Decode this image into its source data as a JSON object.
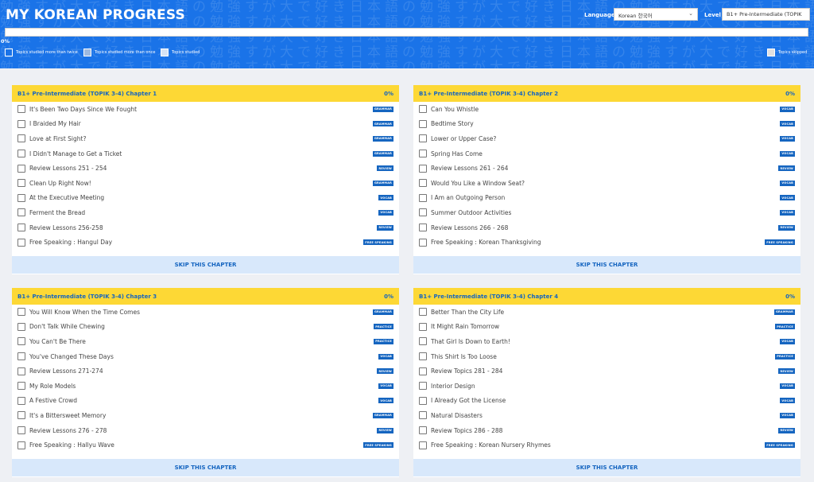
{
  "header": {
    "title": "MY KOREAN PROGRESS",
    "pattern_text": "勉強すが大で好き日本語の勉強すが大で好き日本語の勉強すが大で好き日本語の勉強すが大で好き日本語の勉強すが大で好き日本語の勉強すが大で好き日本語の勉強すが大で好き日本語の",
    "language_label": "Language",
    "language_value": "Korean 한국어",
    "level_label": "Level",
    "level_value": "B1+ Pre-Intermediate (TOPIK",
    "progress_percent": 0,
    "progress_text": "0%"
  },
  "legend": {
    "twice": "Topics studied more than twice",
    "once": "Topics studied more than once",
    "studied": "Topics studied",
    "skipped": "Topics skipped"
  },
  "colors": {
    "header_blue": "#1a73e8",
    "chapter_yellow": "#fdd835",
    "badge_blue": "#1565c0"
  },
  "chapters": [
    {
      "title": "B1+ Pre-Intermediate (TOPIK 3-4) Chapter 1",
      "percent": "0%",
      "skip_label": "SKIP THIS CHAPTER",
      "items": [
        {
          "label": "It's Been Two Days Since We Fought",
          "tag": "GRAMMAR"
        },
        {
          "label": "I Braided My Hair",
          "tag": "GRAMMAR"
        },
        {
          "label": "Love at First Sight?",
          "tag": "GRAMMAR"
        },
        {
          "label": "I Didn't Manage to Get a Ticket",
          "tag": "GRAMMAR"
        },
        {
          "label": "Review Lessons 251 - 254",
          "tag": "REVIEW"
        },
        {
          "label": "Clean Up Right Now!",
          "tag": "GRAMMAR"
        },
        {
          "label": "At the Executive Meeting",
          "tag": "VOCAB"
        },
        {
          "label": "Ferment the Bread",
          "tag": "VOCAB"
        },
        {
          "label": "Review Lessons 256-258",
          "tag": "REVIEW"
        },
        {
          "label": "Free Speaking : Hangul Day",
          "tag": "FREE SPEAKING"
        }
      ]
    },
    {
      "title": "B1+ Pre-Intermediate (TOPIK 3-4) Chapter 2",
      "percent": "0%",
      "skip_label": "SKIP THIS CHAPTER",
      "items": [
        {
          "label": "Can You Whistle",
          "tag": "VOCAB"
        },
        {
          "label": "Bedtime Story",
          "tag": "VOCAB"
        },
        {
          "label": "Lower or Upper Case?",
          "tag": "VOCAB"
        },
        {
          "label": "Spring Has Come",
          "tag": "VOCAB"
        },
        {
          "label": "Review Lessons 261 - 264",
          "tag": "REVIEW"
        },
        {
          "label": "Would You Like a Window  Seat?",
          "tag": "VOCAB"
        },
        {
          "label": "I Am an Outgoing Person",
          "tag": "VOCAB"
        },
        {
          "label": "Summer Outdoor Activities",
          "tag": "VOCAB"
        },
        {
          "label": "Review Lessons 266 - 268",
          "tag": "REVIEW"
        },
        {
          "label": "Free Speaking : Korean Thanksgiving",
          "tag": "FREE SPEAKING"
        }
      ]
    },
    {
      "title": "B1+ Pre-Intermediate (TOPIK 3-4) Chapter 3",
      "percent": "0%",
      "skip_label": "SKIP THIS CHAPTER",
      "items": [
        {
          "label": "You Will Know When the Time Comes",
          "tag": "GRAMMAR"
        },
        {
          "label": "Don't Talk While Chewing",
          "tag": "PRACTICE"
        },
        {
          "label": "You Can't Be There",
          "tag": "PRACTICE"
        },
        {
          "label": "You've Changed These Days",
          "tag": "VOCAB"
        },
        {
          "label": "Review Lessons 271-274",
          "tag": "REVIEW"
        },
        {
          "label": "My Role Models",
          "tag": "VOCAB"
        },
        {
          "label": "A Festive Crowd",
          "tag": "VOCAB"
        },
        {
          "label": "It's a Bittersweet Memory",
          "tag": "GRAMMAR"
        },
        {
          "label": "Review Lessons 276 - 278",
          "tag": "REVIEW"
        },
        {
          "label": "Free Speaking : Hallyu Wave",
          "tag": "FREE SPEAKING"
        }
      ]
    },
    {
      "title": "B1+ Pre-Intermediate (TOPIK 3-4) Chapter 4",
      "percent": "0%",
      "skip_label": "SKIP THIS CHAPTER",
      "items": [
        {
          "label": "Better Than the City Life",
          "tag": "GRAMMAR"
        },
        {
          "label": "It Might Rain Tomorrow",
          "tag": "PRACTICE"
        },
        {
          "label": "That Girl Is Down to Earth!",
          "tag": "VOCAB"
        },
        {
          "label": "This Shirt Is Too Loose",
          "tag": "PRACTICE"
        },
        {
          "label": "Review Topics 281 - 284",
          "tag": "REVIEW"
        },
        {
          "label": "Interior Design",
          "tag": "VOCAB"
        },
        {
          "label": "I Already Got the License",
          "tag": "VOCAB"
        },
        {
          "label": "Natural Disasters",
          "tag": "VOCAB"
        },
        {
          "label": "Review Topics 286 - 288",
          "tag": "REVIEW"
        },
        {
          "label": "Free Speaking : Korean Nursery Rhymes",
          "tag": "FREE SPEAKING"
        }
      ]
    }
  ]
}
